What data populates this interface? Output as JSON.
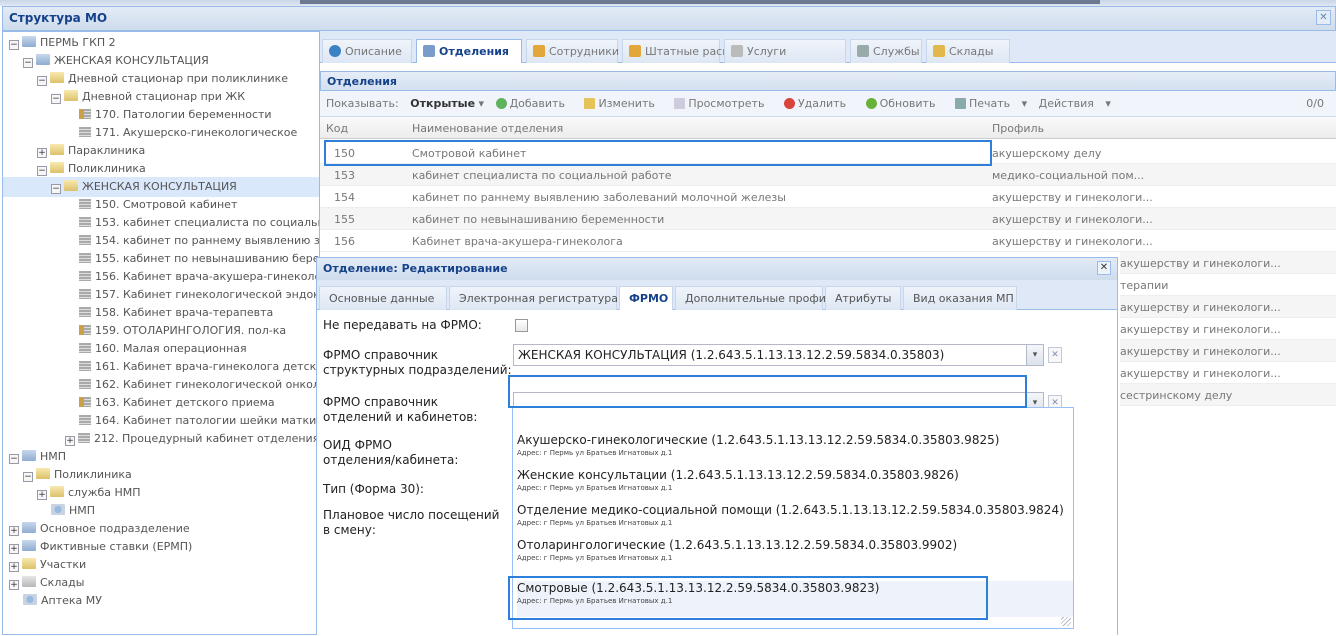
{
  "window_title": "Структура МО",
  "tree": [
    {
      "label": "ПЕРМЬ ГКП 2",
      "toggle": "−",
      "icon": "folder-blue"
    },
    {
      "label": "ЖЕНСКАЯ КОНСУЛЬТАЦИЯ",
      "toggle": "−",
      "icon": "folder-blue"
    },
    {
      "label": "Дневной стационар при поликлинике",
      "toggle": "−",
      "icon": "folder-yellow"
    },
    {
      "label": "Дневной стационар при ЖК",
      "toggle": "−",
      "icon": "folder-yellow"
    },
    {
      "label": "170. Патологии беременности",
      "icon": "lock-doc"
    },
    {
      "label": "171. Акушерско-гинекологическое",
      "icon": "doc"
    },
    {
      "label": "Параклиника",
      "toggle": "+",
      "icon": "folder-yellow"
    },
    {
      "label": "Поликлиника",
      "toggle": "−",
      "icon": "folder-yellow"
    },
    {
      "label": "ЖЕНСКАЯ КОНСУЛЬТАЦИЯ",
      "toggle": "−",
      "icon": "folder-yellow"
    },
    {
      "label": "150. Смотровой кабинет",
      "icon": "doc"
    },
    {
      "label": "153. кабинет специалиста по социальн",
      "icon": "doc"
    },
    {
      "label": "154. кабинет по раннему выявлению за",
      "icon": "doc"
    },
    {
      "label": "155. кабинет по невынашиванию берем",
      "icon": "doc"
    },
    {
      "label": "156. Кабинет врача-акушера-гинеколог",
      "icon": "doc"
    },
    {
      "label": "157. Кабинет гинекологической эндокр",
      "icon": "doc"
    },
    {
      "label": "158. Кабинет врача-терапевта",
      "icon": "doc"
    },
    {
      "label": "159. ОТОЛАРИНГОЛОГИЯ. пол-ка",
      "icon": "lock-doc"
    },
    {
      "label": "160. Малая операционная",
      "icon": "doc"
    },
    {
      "label": "161. Кабинет врача-гинеколога детско",
      "icon": "doc"
    },
    {
      "label": "162. Кабинет гинекологической онколо",
      "icon": "doc"
    },
    {
      "label": "163. Кабинет детского приема",
      "icon": "lock-doc"
    },
    {
      "label": "164. Кабинет патологии шейки матки",
      "icon": "doc"
    },
    {
      "label": "212. Процедурный кабинет отделения г",
      "toggle": "+",
      "icon": "doc"
    },
    {
      "label": "НМП",
      "toggle": "−",
      "icon": "folder-blue"
    },
    {
      "label": "Поликлиника",
      "toggle": "−",
      "icon": "folder-yellow"
    },
    {
      "label": "служба НМП",
      "toggle": "+",
      "icon": "folder-yellow"
    },
    {
      "label": "НМП",
      "icon": "service"
    },
    {
      "label": "Основное подразделение",
      "toggle": "+",
      "icon": "folder-blue"
    },
    {
      "label": "Фиктивные ставки (ЕРМП)",
      "toggle": "+",
      "icon": "folder-blue"
    },
    {
      "label": "Участки",
      "toggle": "+",
      "icon": "folder-yellow"
    },
    {
      "label": "Склады",
      "toggle": "+",
      "icon": "folder-grey"
    },
    {
      "label": "Аптека МУ",
      "icon": "service"
    }
  ],
  "tabs": [
    "Описание",
    "Отделения",
    "Сотрудники",
    "Штатные расписания",
    "Услуги",
    "Службы",
    "Склады"
  ],
  "section_title": "Отделения",
  "toolbar": {
    "show_label": "Показывать:",
    "show_value": "Открытые",
    "add": "Добавить",
    "edit": "Изменить",
    "view": "Просмотреть",
    "delete": "Удалить",
    "refresh": "Обновить",
    "print": "Печать",
    "actions": "Действия",
    "pager": "0/0"
  },
  "grid": {
    "headers": {
      "code": "Код",
      "name": "Наименование отделения",
      "profile": "Профиль"
    },
    "rows": [
      {
        "code": "150",
        "name": "Смотровой кабинет",
        "profile": "акушерскому делу"
      },
      {
        "code": "153",
        "name": "кабинет специалиста по социальной работе",
        "profile": "медико-социальной пом..."
      },
      {
        "code": "154",
        "name": "кабинет по раннему выявлению заболеваний молочной железы",
        "profile": "акушерству и гинекологи..."
      },
      {
        "code": "155",
        "name": "кабинет по невынашиванию беременности",
        "profile": "акушерству и гинекологи..."
      },
      {
        "code": "156",
        "name": "Кабинет врача-акушера-гинеколога",
        "profile": "акушерству и гинекологи..."
      }
    ],
    "extra_profiles": [
      "акушерству и гинекологи...",
      "терапии",
      "акушерству и гинекологи...",
      "акушерству и гинекологи...",
      "акушерству и гинекологи...",
      "акушерству и гинекологи...",
      "сестринскому делу"
    ]
  },
  "dialog": {
    "title": "Отделение: Редактирование",
    "tabs": [
      "Основные данные",
      "Электронная регистратура",
      "ФРМО",
      "Дополнительные профили",
      "Атрибуты",
      "Вид оказания МП"
    ],
    "fields": {
      "no_send_label": "Не передавать на ФРМО:",
      "struct_label_1": "ФРМО справочник",
      "struct_label_2": "структурных подразделений:",
      "struct_value": "ЖЕНСКАЯ КОНСУЛЬТАЦИЯ (1.2.643.5.1.13.13.12.2.59.5834.0.35803)",
      "dept_label_1": "ФРМО справочник",
      "dept_label_2": "отделений и кабинетов:",
      "dept_value": "",
      "oid_label_1": "ОИД ФРМО",
      "oid_label_2": "отделения/кабинета:",
      "type_label": "Тип (Форма 30):",
      "plan_label_1": "Плановое число посещений",
      "plan_label_2": "в смену:"
    },
    "options": [
      {
        "name": "Акушерско-гинекологические (1.2.643.5.1.13.13.12.2.59.5834.0.35803.9825)",
        "address": "Адрес: г Пермь ул Братьев Игнатовых д.1"
      },
      {
        "name": "Женские консультации (1.2.643.5.1.13.13.12.2.59.5834.0.35803.9826)",
        "address": "Адрес: г Пермь ул Братьев Игнатовых д.1"
      },
      {
        "name": "Отделение медико-социальной помощи (1.2.643.5.1.13.13.12.2.59.5834.0.35803.9824)",
        "address": "Адрес: г Пермь ул Братьев Игнатовых д.1"
      },
      {
        "name": "Отоларингологические (1.2.643.5.1.13.13.12.2.59.5834.0.35803.9902)",
        "address": "Адрес: г Пермь ул Братьев Игнатовых д.1"
      },
      {
        "name": "Смотровые (1.2.643.5.1.13.13.12.2.59.5834.0.35803.9823)",
        "address": "Адрес: г Пермь ул Братьев Игнатовых д.1"
      }
    ]
  },
  "colors": {
    "accent": "#15428b",
    "highlight": "#2e7fd9",
    "border": "#99bbe8"
  }
}
